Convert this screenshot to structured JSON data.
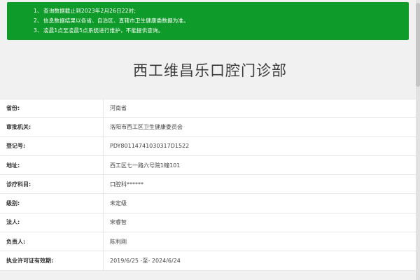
{
  "notice": {
    "items": [
      {
        "num": "1、",
        "text": "查询数据截止到2023年2月26日22时;"
      },
      {
        "num": "2、",
        "text": "信息数据结果以各省、自治区、直辖市卫生健康委数据为准。"
      },
      {
        "num": "3、",
        "text": "凌晨1点至凌晨5点系统进行维护，不能提供查询。"
      }
    ]
  },
  "page": {
    "title": "西工维昌乐口腔门诊部"
  },
  "info": {
    "rows": [
      {
        "label": "省份:",
        "value": "河南省"
      },
      {
        "label": "审批机关:",
        "value": "洛阳市西工区卫生健康委员会"
      },
      {
        "label": "登记号:",
        "value": "PDY80114741030317D1522"
      },
      {
        "label": "地址:",
        "value": "西工区七一路六号院1幢101"
      },
      {
        "label": "诊疗科目:",
        "value": "口腔科******"
      },
      {
        "label": "级别:",
        "value": "未定级"
      },
      {
        "label": "法人:",
        "value": "宋睿智"
      },
      {
        "label": "负责人:",
        "value": "陈利刚"
      },
      {
        "label": "执业许可证有效期:",
        "value": "2019/6/25 -至- 2024/6/24"
      }
    ]
  }
}
